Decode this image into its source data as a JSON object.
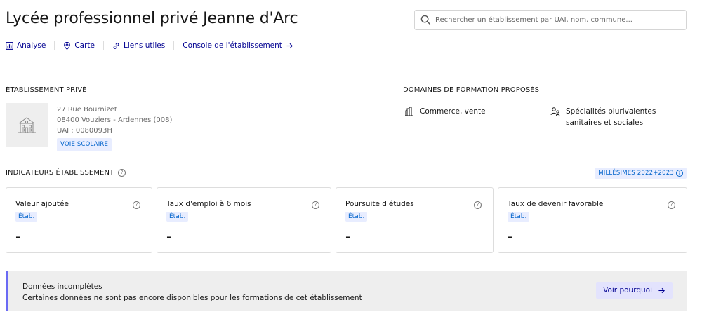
{
  "header": {
    "title": "Lycée professionnel privé Jeanne d'Arc",
    "search_placeholder": "Rechercher un établissement par UAI, nom, commune..."
  },
  "nav": {
    "items": [
      {
        "label": "Analyse",
        "icon": "chart-icon"
      },
      {
        "label": "Carte",
        "icon": "map-pin-icon"
      },
      {
        "label": "Liens utiles",
        "icon": "link-icon"
      },
      {
        "label": "Console de l'établissement",
        "icon": "arrow-right-icon"
      }
    ]
  },
  "etablissement": {
    "section_label": "ÉTABLISSEMENT PRIVÉ",
    "address_line1": "27 Rue Bournizet",
    "address_line2": "08400 Vouziers - Ardennes (008)",
    "uai": "UAI : 0080093H",
    "voie_badge": "VOIE SCOLAIRE"
  },
  "domaines": {
    "section_label": "DOMAINES DE FORMATION PROPOSÉS",
    "items": [
      {
        "label": "Commerce, vente",
        "icon": "shop-icon"
      },
      {
        "label_line1": "Spécialités plurivalentes",
        "label_line2": "sanitaires et sociales",
        "icon": "people-icon"
      }
    ]
  },
  "indicateurs": {
    "section_label": "INDICATEURS ÉTABLISSEMENT",
    "millesimes": "MILLÉSIMES 2022+2023",
    "help_glyph": "?",
    "cards": [
      {
        "title": "Valeur ajoutée",
        "badge": "Étab.",
        "value": "-"
      },
      {
        "title": "Taux d'emploi à 6 mois",
        "badge": "Étab.",
        "value": "-"
      },
      {
        "title": "Poursuite d'études",
        "badge": "Étab.",
        "value": "-"
      },
      {
        "title": "Taux de devenir favorable",
        "badge": "Étab.",
        "value": "-"
      }
    ]
  },
  "banner": {
    "title": "Données incomplètes",
    "text": "Certaines données ne sont pas encore disponibles pour les formations de cet établissement",
    "button_label": "Voir pourquoi"
  },
  "colors": {
    "accent": "#000091",
    "badge_bg": "#e8edff",
    "badge_text": "#0063cb",
    "banner_border": "#6a6af4"
  }
}
